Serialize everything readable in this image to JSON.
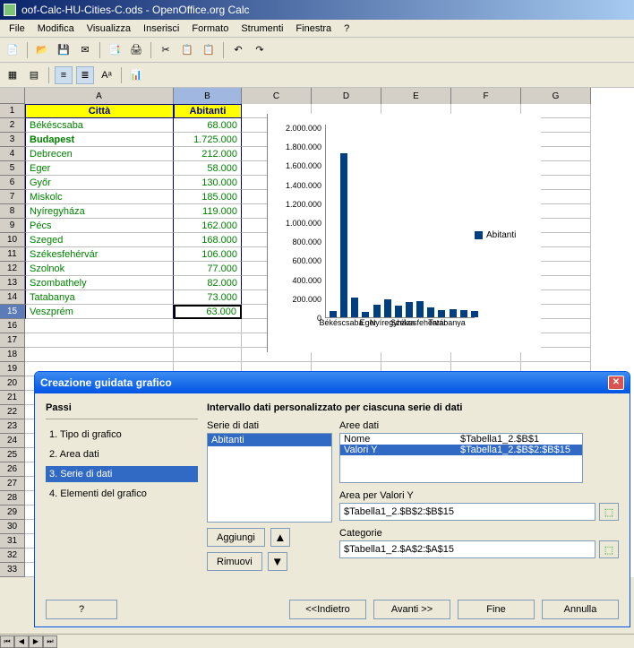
{
  "window": {
    "title": "oof-Calc-HU-Cities-C.ods - OpenOffice.org Calc"
  },
  "menu": {
    "file": "File",
    "modifica": "Modifica",
    "visualizza": "Visualizza",
    "inserisci": "Inserisci",
    "formato": "Formato",
    "strumenti": "Strumenti",
    "finestra": "Finestra",
    "help": "?"
  },
  "columns": [
    "A",
    "B",
    "C",
    "D",
    "E",
    "F",
    "G"
  ],
  "headers": {
    "a": "Città",
    "b": "Abitanti"
  },
  "rows": [
    {
      "n": "1",
      "a": "Città",
      "b": "Abitanti",
      "hdr": true
    },
    {
      "n": "2",
      "a": "Békéscsaba",
      "b": "68.000"
    },
    {
      "n": "3",
      "a": "Budapest",
      "b": "1.725.000",
      "bold": true
    },
    {
      "n": "4",
      "a": "Debrecen",
      "b": "212.000"
    },
    {
      "n": "5",
      "a": "Eger",
      "b": "58.000"
    },
    {
      "n": "6",
      "a": "Győr",
      "b": "130.000"
    },
    {
      "n": "7",
      "a": "Miskolc",
      "b": "185.000"
    },
    {
      "n": "8",
      "a": "Nyíregyháza",
      "b": "119.000"
    },
    {
      "n": "9",
      "a": "Pécs",
      "b": "162.000"
    },
    {
      "n": "10",
      "a": "Szeged",
      "b": "168.000"
    },
    {
      "n": "11",
      "a": "Székesfehérvár",
      "b": "106.000"
    },
    {
      "n": "12",
      "a": "Szolnok",
      "b": "77.000"
    },
    {
      "n": "13",
      "a": "Szombathely",
      "b": "82.000"
    },
    {
      "n": "14",
      "a": "Tatabanya",
      "b": "73.000"
    },
    {
      "n": "15",
      "a": "Veszprém",
      "b": "63.000",
      "sel": true
    }
  ],
  "chart_data": {
    "type": "bar",
    "title": "",
    "xlabel": "",
    "ylabel": "",
    "ylim": [
      0,
      2000000
    ],
    "y_ticks": [
      "0",
      "200.000",
      "400.000",
      "600.000",
      "800.000",
      "1.000.000",
      "1.200.000",
      "1.400.000",
      "1.600.000",
      "1.800.000",
      "2.000.000"
    ],
    "categories": [
      "Békéscsaba",
      "Budapest",
      "Debrecen",
      "Eger",
      "Győr",
      "Miskolc",
      "Nyíregyháza",
      "Pécs",
      "Szeged",
      "Székesfehérvár",
      "Szolnok",
      "Szombathely",
      "Tatabanya",
      "Veszprém"
    ],
    "series": [
      {
        "name": "Abitanti",
        "values": [
          68000,
          1725000,
          212000,
          58000,
          130000,
          185000,
          119000,
          162000,
          168000,
          106000,
          77000,
          82000,
          73000,
          63000
        ]
      }
    ],
    "x_visible_labels": [
      "Eger",
      "Székesfehérvár",
      "Békéscsaba",
      "Nyíregyháza",
      "Tatabanya"
    ],
    "legend": "Abitanti"
  },
  "dialog": {
    "title": "Creazione guidata grafico",
    "steps_title": "Passi",
    "steps": [
      "1. Tipo di grafico",
      "2. Area dati",
      "3. Serie di dati",
      "4. Elementi del grafico"
    ],
    "selected_step": 2,
    "right_title": "Intervallo dati personalizzato per ciascuna serie di dati",
    "series_label": "Serie di dati",
    "series_item": "Abitanti",
    "area_label": "Aree dati",
    "area_rows": [
      {
        "name": "Nome",
        "range": "$Tabella1_2.$B$1"
      },
      {
        "name": "Valori Y",
        "range": "$Tabella1_2.$B$2:$B$15"
      }
    ],
    "area_selected": 1,
    "valori_label": "Area per Valori Y",
    "valori_value": "$Tabella1_2.$B$2:$B$15",
    "cat_label": "Categorie",
    "cat_value": "$Tabella1_2.$A$2:$A$15",
    "btn_add": "Aggiungi",
    "btn_remove": "Rimuovi",
    "btn_help": "?",
    "btn_back": "<<Indietro",
    "btn_next": "Avanti >>",
    "btn_finish": "Fine",
    "btn_cancel": "Annulla"
  }
}
